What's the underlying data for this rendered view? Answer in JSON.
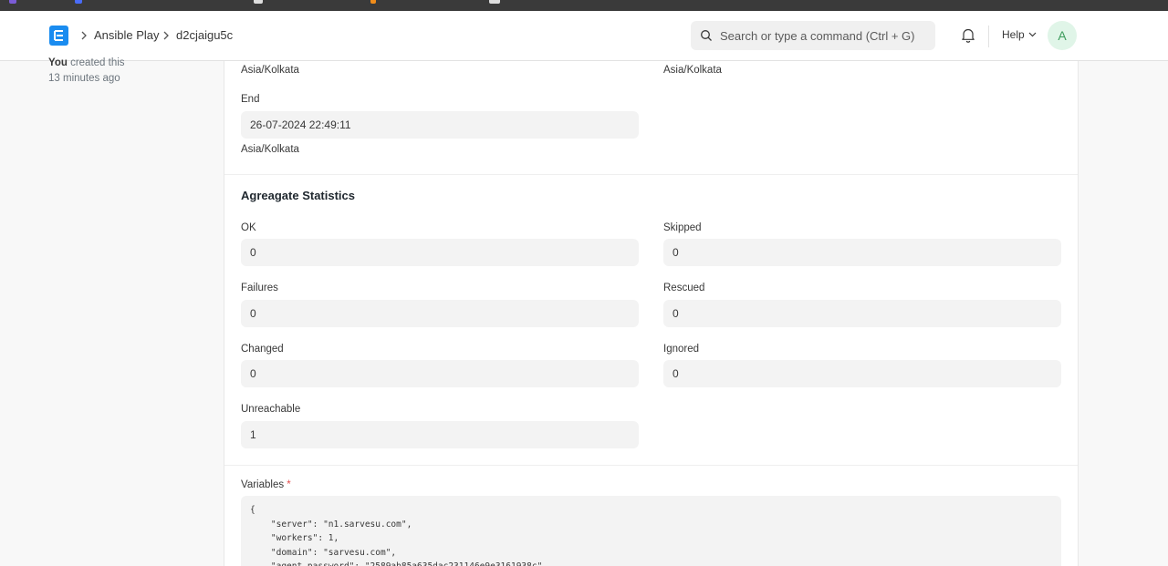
{
  "navbar": {
    "breadcrumbs": [
      "Ansible Play",
      "d2cjaigu5c"
    ],
    "search_placeholder": "Search or type a command (Ctrl + G)",
    "help_label": "Help",
    "avatar_initial": "A"
  },
  "sidebar": {
    "created_by": "You",
    "created_text": "created this",
    "created_ago": "13 minutes ago"
  },
  "timing": {
    "start_tz_left": "Asia/Kolkata",
    "start_tz_right": "Asia/Kolkata",
    "end_label": "End",
    "end_value": "26-07-2024 22:49:11",
    "end_tz": "Asia/Kolkata"
  },
  "stats": {
    "title": "Agreagate Statistics",
    "ok": {
      "label": "OK",
      "value": "0"
    },
    "skipped": {
      "label": "Skipped",
      "value": "0"
    },
    "failures": {
      "label": "Failures",
      "value": "0"
    },
    "rescued": {
      "label": "Rescued",
      "value": "0"
    },
    "changed": {
      "label": "Changed",
      "value": "0"
    },
    "ignored": {
      "label": "Ignored",
      "value": "0"
    },
    "unreachable": {
      "label": "Unreachable",
      "value": "1"
    }
  },
  "variables": {
    "label": "Variables",
    "required_mark": "*",
    "code": "{\n    \"server\": \"n1.sarvesu.com\",\n    \"workers\": 1,\n    \"domain\": \"sarvesu.com\",\n    \"agent_password\": \"2589ab85a635dac231146e9e3161938c\","
  },
  "colors": {
    "accent": "#1a8cf0",
    "avatar_bg": "#e0f5e8",
    "avatar_fg": "#3d9c5c",
    "required": "#e24c4c"
  },
  "icons": [
    "app-logo-icon",
    "chevron-right-icon",
    "search-icon",
    "bell-icon",
    "chevron-down-icon"
  ]
}
